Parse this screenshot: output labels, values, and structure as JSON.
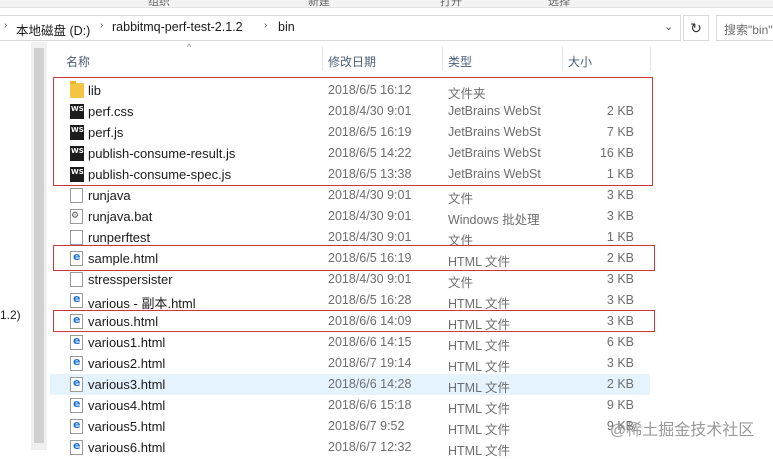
{
  "ribbon": {
    "items": [
      "组织",
      "新建",
      "打开",
      "选择"
    ]
  },
  "address_bar": {
    "crumbs": [
      "本地磁盘 (D:)",
      "rabbitmq-perf-test-2.1.2",
      "bin"
    ],
    "search_placeholder": "搜索\"bin\""
  },
  "nav_pane": {
    "fragment": "1.2)"
  },
  "columns": {
    "name": "名称",
    "date": "修改日期",
    "type": "类型",
    "size": "大小"
  },
  "files": [
    {
      "icon": "folder-icon",
      "name": "lib",
      "date": "2018/6/5 16:12",
      "type": "文件夹",
      "size": ""
    },
    {
      "icon": "webstorm-file-icon",
      "name": "perf.css",
      "date": "2018/4/30 9:01",
      "type": "JetBrains WebSt",
      "size": "2 KB"
    },
    {
      "icon": "webstorm-file-icon",
      "name": "perf.js",
      "date": "2018/6/5 16:19",
      "type": "JetBrains WebSt",
      "size": "7 KB"
    },
    {
      "icon": "webstorm-file-icon",
      "name": "publish-consume-result.js",
      "date": "2018/6/5 14:22",
      "type": "JetBrains WebSt",
      "size": "16 KB"
    },
    {
      "icon": "webstorm-file-icon",
      "name": "publish-consume-spec.js",
      "date": "2018/6/5 13:38",
      "type": "JetBrains WebSt",
      "size": "1 KB"
    },
    {
      "icon": "file-icon",
      "name": "runjava",
      "date": "2018/4/30 9:01",
      "type": "文件",
      "size": "3 KB"
    },
    {
      "icon": "batch-file-icon",
      "name": "runjava.bat",
      "date": "2018/4/30 9:01",
      "type": "Windows 批处理",
      "size": "3 KB"
    },
    {
      "icon": "file-icon",
      "name": "runperftest",
      "date": "2018/4/30 9:01",
      "type": "文件",
      "size": "1 KB"
    },
    {
      "icon": "html-file-icon",
      "name": "sample.html",
      "date": "2018/6/5 16:19",
      "type": "HTML 文件",
      "size": "2 KB"
    },
    {
      "icon": "file-icon",
      "name": "stresspersister",
      "date": "2018/4/30 9:01",
      "type": "文件",
      "size": "3 KB"
    },
    {
      "icon": "html-file-icon",
      "name": "various - 副本.html",
      "date": "2018/6/5 16:28",
      "type": "HTML 文件",
      "size": "3 KB"
    },
    {
      "icon": "html-file-icon",
      "name": "various.html",
      "date": "2018/6/6 14:09",
      "type": "HTML 文件",
      "size": "3 KB"
    },
    {
      "icon": "html-file-icon",
      "name": "various1.html",
      "date": "2018/6/6 14:15",
      "type": "HTML 文件",
      "size": "6 KB"
    },
    {
      "icon": "html-file-icon",
      "name": "various2.html",
      "date": "2018/6/7 19:14",
      "type": "HTML 文件",
      "size": "3 KB"
    },
    {
      "icon": "html-file-icon",
      "name": "various3.html",
      "date": "2018/6/6 14:28",
      "type": "HTML 文件",
      "size": "2 KB",
      "selected": true
    },
    {
      "icon": "html-file-icon",
      "name": "various4.html",
      "date": "2018/6/6 15:18",
      "type": "HTML 文件",
      "size": "9 KB"
    },
    {
      "icon": "html-file-icon",
      "name": "various5.html",
      "date": "2018/6/7 9:52",
      "type": "HTML 文件",
      "size": "9 KB"
    },
    {
      "icon": "html-file-icon",
      "name": "various6.html",
      "date": "2018/6/7 12:32",
      "type": "HTML 文件",
      "size": ""
    }
  ],
  "annotation_color": "#c9363f",
  "watermark": "@稀土掘金技术社区"
}
